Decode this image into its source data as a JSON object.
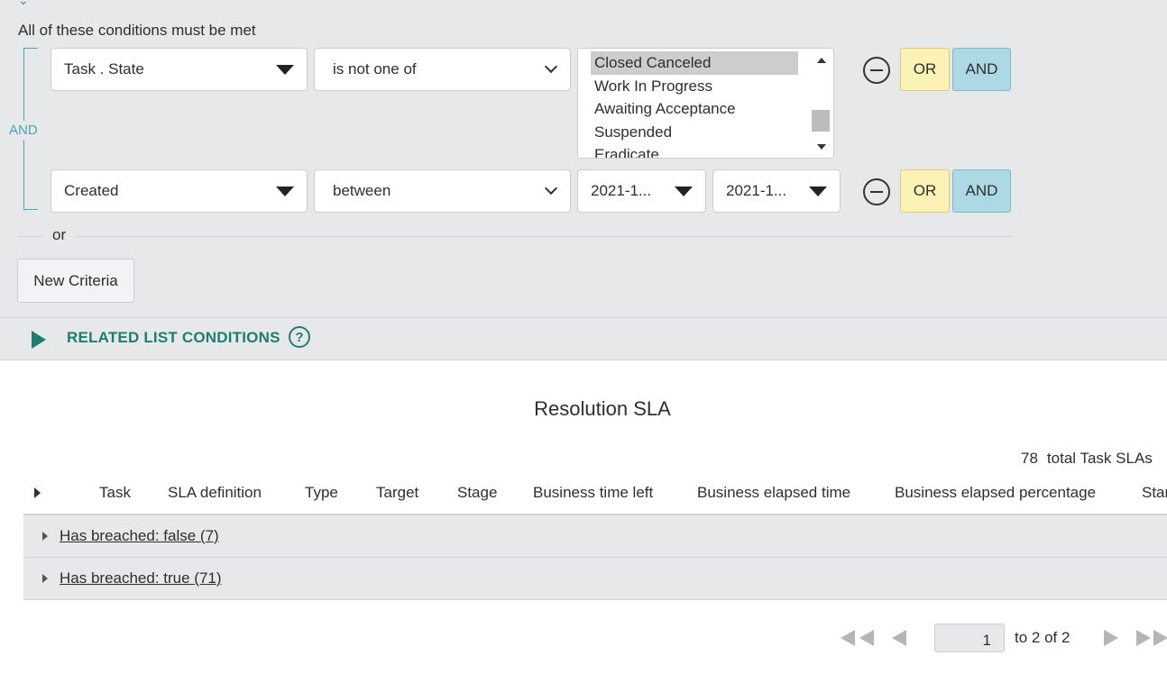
{
  "filter": {
    "conditions_title": "All of these conditions must be met",
    "group_connector": "AND",
    "row1": {
      "field": "Task . State",
      "operator": "is not one of",
      "options": [
        "Closed Canceled",
        "Work In Progress",
        "Awaiting Acceptance",
        "Suspended",
        "Eradicate"
      ],
      "selected": "Closed Canceled",
      "or_label": "OR",
      "and_label": "AND"
    },
    "row2": {
      "field": "Created",
      "operator": "between",
      "from": "2021-1...",
      "to": "2021-1...",
      "or_label": "OR",
      "and_label": "AND"
    },
    "or_divider": "or",
    "new_criteria_label": "New Criteria"
  },
  "related_list": {
    "label": "RELATED LIST CONDITIONS",
    "help_glyph": "?"
  },
  "list": {
    "title": "Resolution SLA",
    "total_count": "78",
    "total_label": "total Task SLAs",
    "columns": [
      "Task",
      "SLA definition",
      "Type",
      "Target",
      "Stage",
      "Business time left",
      "Business elapsed time",
      "Business elapsed percentage",
      "Start time"
    ],
    "groups": [
      {
        "label": "Has breached: false (7)"
      },
      {
        "label": "Has breached: true (71)"
      }
    ]
  },
  "pagination": {
    "current_page": "1",
    "range_text": "to 2 of 2"
  },
  "colors": {
    "filter_bg": "#e6e8ea",
    "or_button": "#fcf2b5",
    "and_button": "#acd9e3",
    "accent_teal": "#1f7d70",
    "connector_blue": "#4aa3b8"
  }
}
